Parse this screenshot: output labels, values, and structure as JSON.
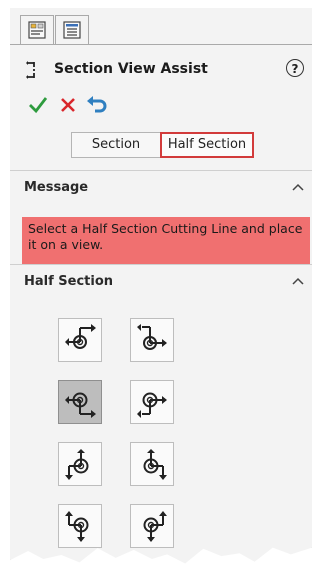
{
  "panel": {
    "title": "Section View Assist",
    "help_glyph": "?"
  },
  "tabs": [
    {
      "icon": "property-manager-icon"
    },
    {
      "icon": "feature-tree-icon"
    }
  ],
  "actions": [
    {
      "icon": "ok-checkmark-icon",
      "color": "#2e9b3e"
    },
    {
      "icon": "cancel-x-icon",
      "color": "#d9262b"
    },
    {
      "icon": "undo-arrow-icon",
      "color": "#2f7fc0"
    }
  ],
  "mode_toggle": {
    "options": [
      "Section",
      "Half Section"
    ],
    "selected": "Half Section",
    "highlight_color": "#d23b3b"
  },
  "message_section": {
    "title": "Message",
    "text": "Select a Half Section Cutting Line and place it on a view.",
    "background": "#f07070"
  },
  "half_section": {
    "title": "Half Section",
    "selected_index": 2,
    "options": [
      {
        "icon": "half-section-top-right-icon"
      },
      {
        "icon": "half-section-top-left-icon"
      },
      {
        "icon": "half-section-bottom-right-icon"
      },
      {
        "icon": "half-section-bottom-left-icon"
      },
      {
        "icon": "half-section-left-down-icon"
      },
      {
        "icon": "half-section-right-down-icon"
      },
      {
        "icon": "half-section-left-up-icon"
      },
      {
        "icon": "half-section-right-up-icon"
      }
    ]
  }
}
